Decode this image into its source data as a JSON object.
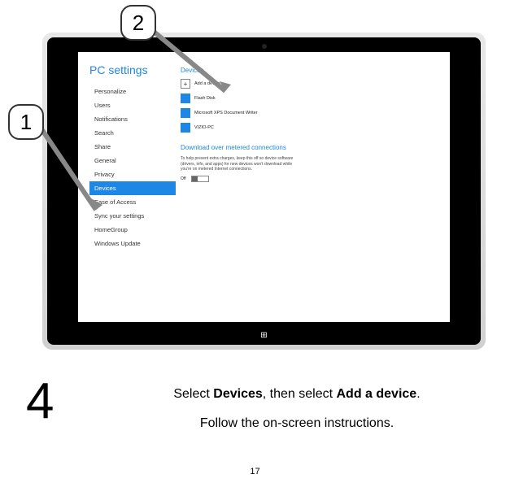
{
  "step_number": "4",
  "page_number": "17",
  "callouts": {
    "one": "1",
    "two": "2"
  },
  "instructions": {
    "line1_pre": "Select ",
    "line1_bold1": "Devices",
    "line1_mid": ", then select ",
    "line1_bold2": "Add a device",
    "line1_post": ".",
    "line2": "Follow the on-screen instructions."
  },
  "screen": {
    "title": "PC settings",
    "nav": [
      "Personalize",
      "Users",
      "Notifications",
      "Search",
      "Share",
      "General",
      "Privacy",
      "Devices",
      "Ease of Access",
      "Sync your settings",
      "HomeGroup",
      "Windows Update"
    ],
    "active_index": 7,
    "section1_title": "Devices",
    "devices": {
      "add": "Add a device",
      "items": [
        "Flash Disk",
        "Microsoft XPS Document Writer",
        "VIZIO-PC"
      ]
    },
    "section2_title": "Download over metered connections",
    "section2_help": "To help prevent extra charges, keep this off so device software (drivers, info, and apps) for new devices won't download while you're on metered Internet connections.",
    "toggle_label": "Off"
  }
}
